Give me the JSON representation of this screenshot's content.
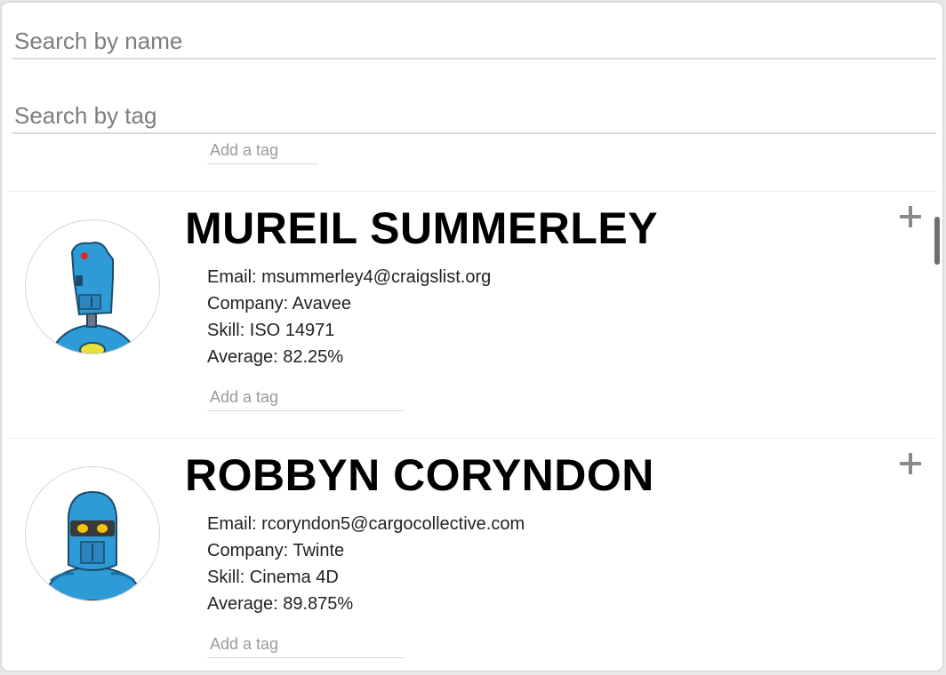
{
  "search": {
    "name_placeholder": "Search by name",
    "tag_placeholder": "Search by tag"
  },
  "previous_student": {
    "tag_placeholder": "Add a tag"
  },
  "students": [
    {
      "name": "MUREIL SUMMERLEY",
      "email": "Email: msummerley4@craigslist.org",
      "company": "Company: Avavee",
      "skill": "Skill: ISO 14971",
      "average": "Average: 82.25%",
      "tag_placeholder": "Add a tag",
      "avatar_icon": "robot-avatar-icon",
      "expand_icon": "plus-icon"
    },
    {
      "name": "ROBBYN CORYNDON",
      "email": "Email: rcoryndon5@cargocollective.com",
      "company": "Company: Twinte",
      "skill": "Skill: Cinema 4D",
      "average": "Average: 89.875%",
      "tag_placeholder": "Add a tag",
      "avatar_icon": "robot-avatar-icon",
      "expand_icon": "plus-icon"
    }
  ],
  "colors": {
    "robot_blue": "#2e9bd6",
    "placeholder_gray": "#7d7d7d",
    "plus_gray": "#8a8a8a"
  }
}
